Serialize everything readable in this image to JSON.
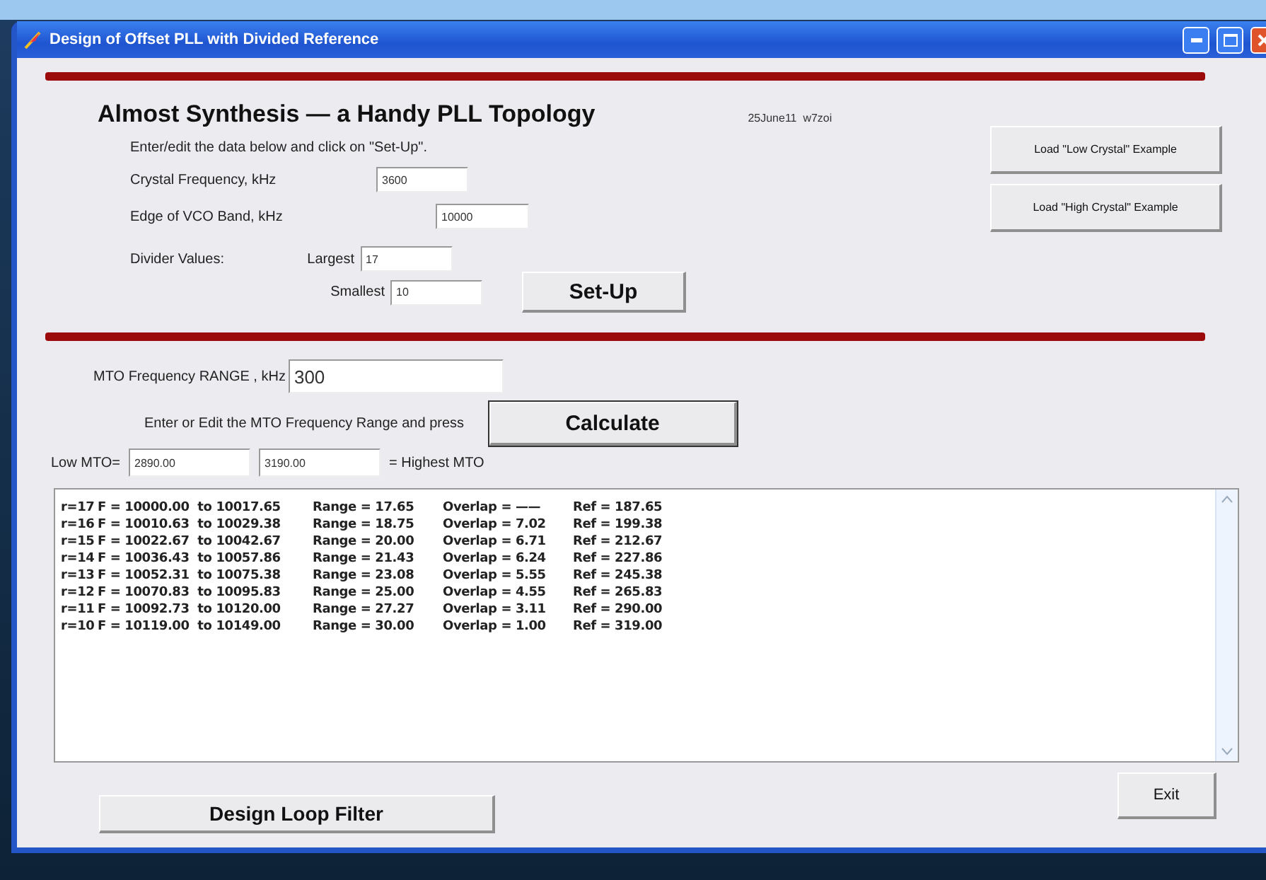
{
  "window": {
    "title": "Design of Offset PLL with Divided Reference"
  },
  "heading": "Almost Synthesis — a Handy PLL Topology",
  "version": "25June11  w7zoi",
  "instruction": "Enter/edit the data below and click on \"Set-Up\".",
  "crystal": {
    "label": "Crystal Frequency, kHz",
    "value": "3600"
  },
  "vco_edge": {
    "label": "Edge of VCO Band, kHz",
    "value": "10000"
  },
  "divider": {
    "label": "Divider Values:",
    "largest_label": "Largest",
    "largest": "17",
    "smallest_label": "Smallest",
    "smallest": "10"
  },
  "setup_button": "Set-Up",
  "example_buttons": [
    "Load \"Low Crystal\" Example",
    "Load \"High Crystal\" Example"
  ],
  "mto_range": {
    "label": "MTO Frequency RANGE , kHz",
    "value": "300"
  },
  "calc_prompt": "Enter or Edit the MTO Frequency Range and press",
  "calculate_button": "Calculate",
  "low_mto": {
    "label": "Low MTO=",
    "value": "2890.00"
  },
  "high_mto": {
    "value": "3190.00",
    "label": "= Highest MTO"
  },
  "results": [
    {
      "r": "r=17",
      "f": "F = 10000.00  to 10017.65",
      "range": "Range = 17.65",
      "overlap": "Overlap = ——",
      "ref": "Ref = 187.65"
    },
    {
      "r": "r=16",
      "f": "F = 10010.63  to 10029.38",
      "range": "Range = 18.75",
      "overlap": "Overlap = 7.02",
      "ref": "Ref = 199.38"
    },
    {
      "r": "r=15",
      "f": "F = 10022.67  to 10042.67",
      "range": "Range = 20.00",
      "overlap": "Overlap = 6.71",
      "ref": "Ref = 212.67"
    },
    {
      "r": "r=14",
      "f": "F = 10036.43  to 10057.86",
      "range": "Range = 21.43",
      "overlap": "Overlap = 6.24",
      "ref": "Ref = 227.86"
    },
    {
      "r": "r=13",
      "f": "F = 10052.31  to 10075.38",
      "range": "Range = 23.08",
      "overlap": "Overlap = 5.55",
      "ref": "Ref = 245.38"
    },
    {
      "r": "r=12",
      "f": "F = 10070.83  to 10095.83",
      "range": "Range = 25.00",
      "overlap": "Overlap = 4.55",
      "ref": "Ref = 265.83"
    },
    {
      "r": "r=11",
      "f": "F = 10092.73  to 10120.00",
      "range": "Range = 27.27",
      "overlap": "Overlap = 3.11",
      "ref": "Ref = 290.00"
    },
    {
      "r": "r=10",
      "f": "F = 10119.00  to 10149.00",
      "range": "Range = 30.00",
      "overlap": "Overlap = 1.00",
      "ref": "Ref = 319.00"
    }
  ],
  "design_button": "Design Loop Filter",
  "exit_button": "Exit"
}
